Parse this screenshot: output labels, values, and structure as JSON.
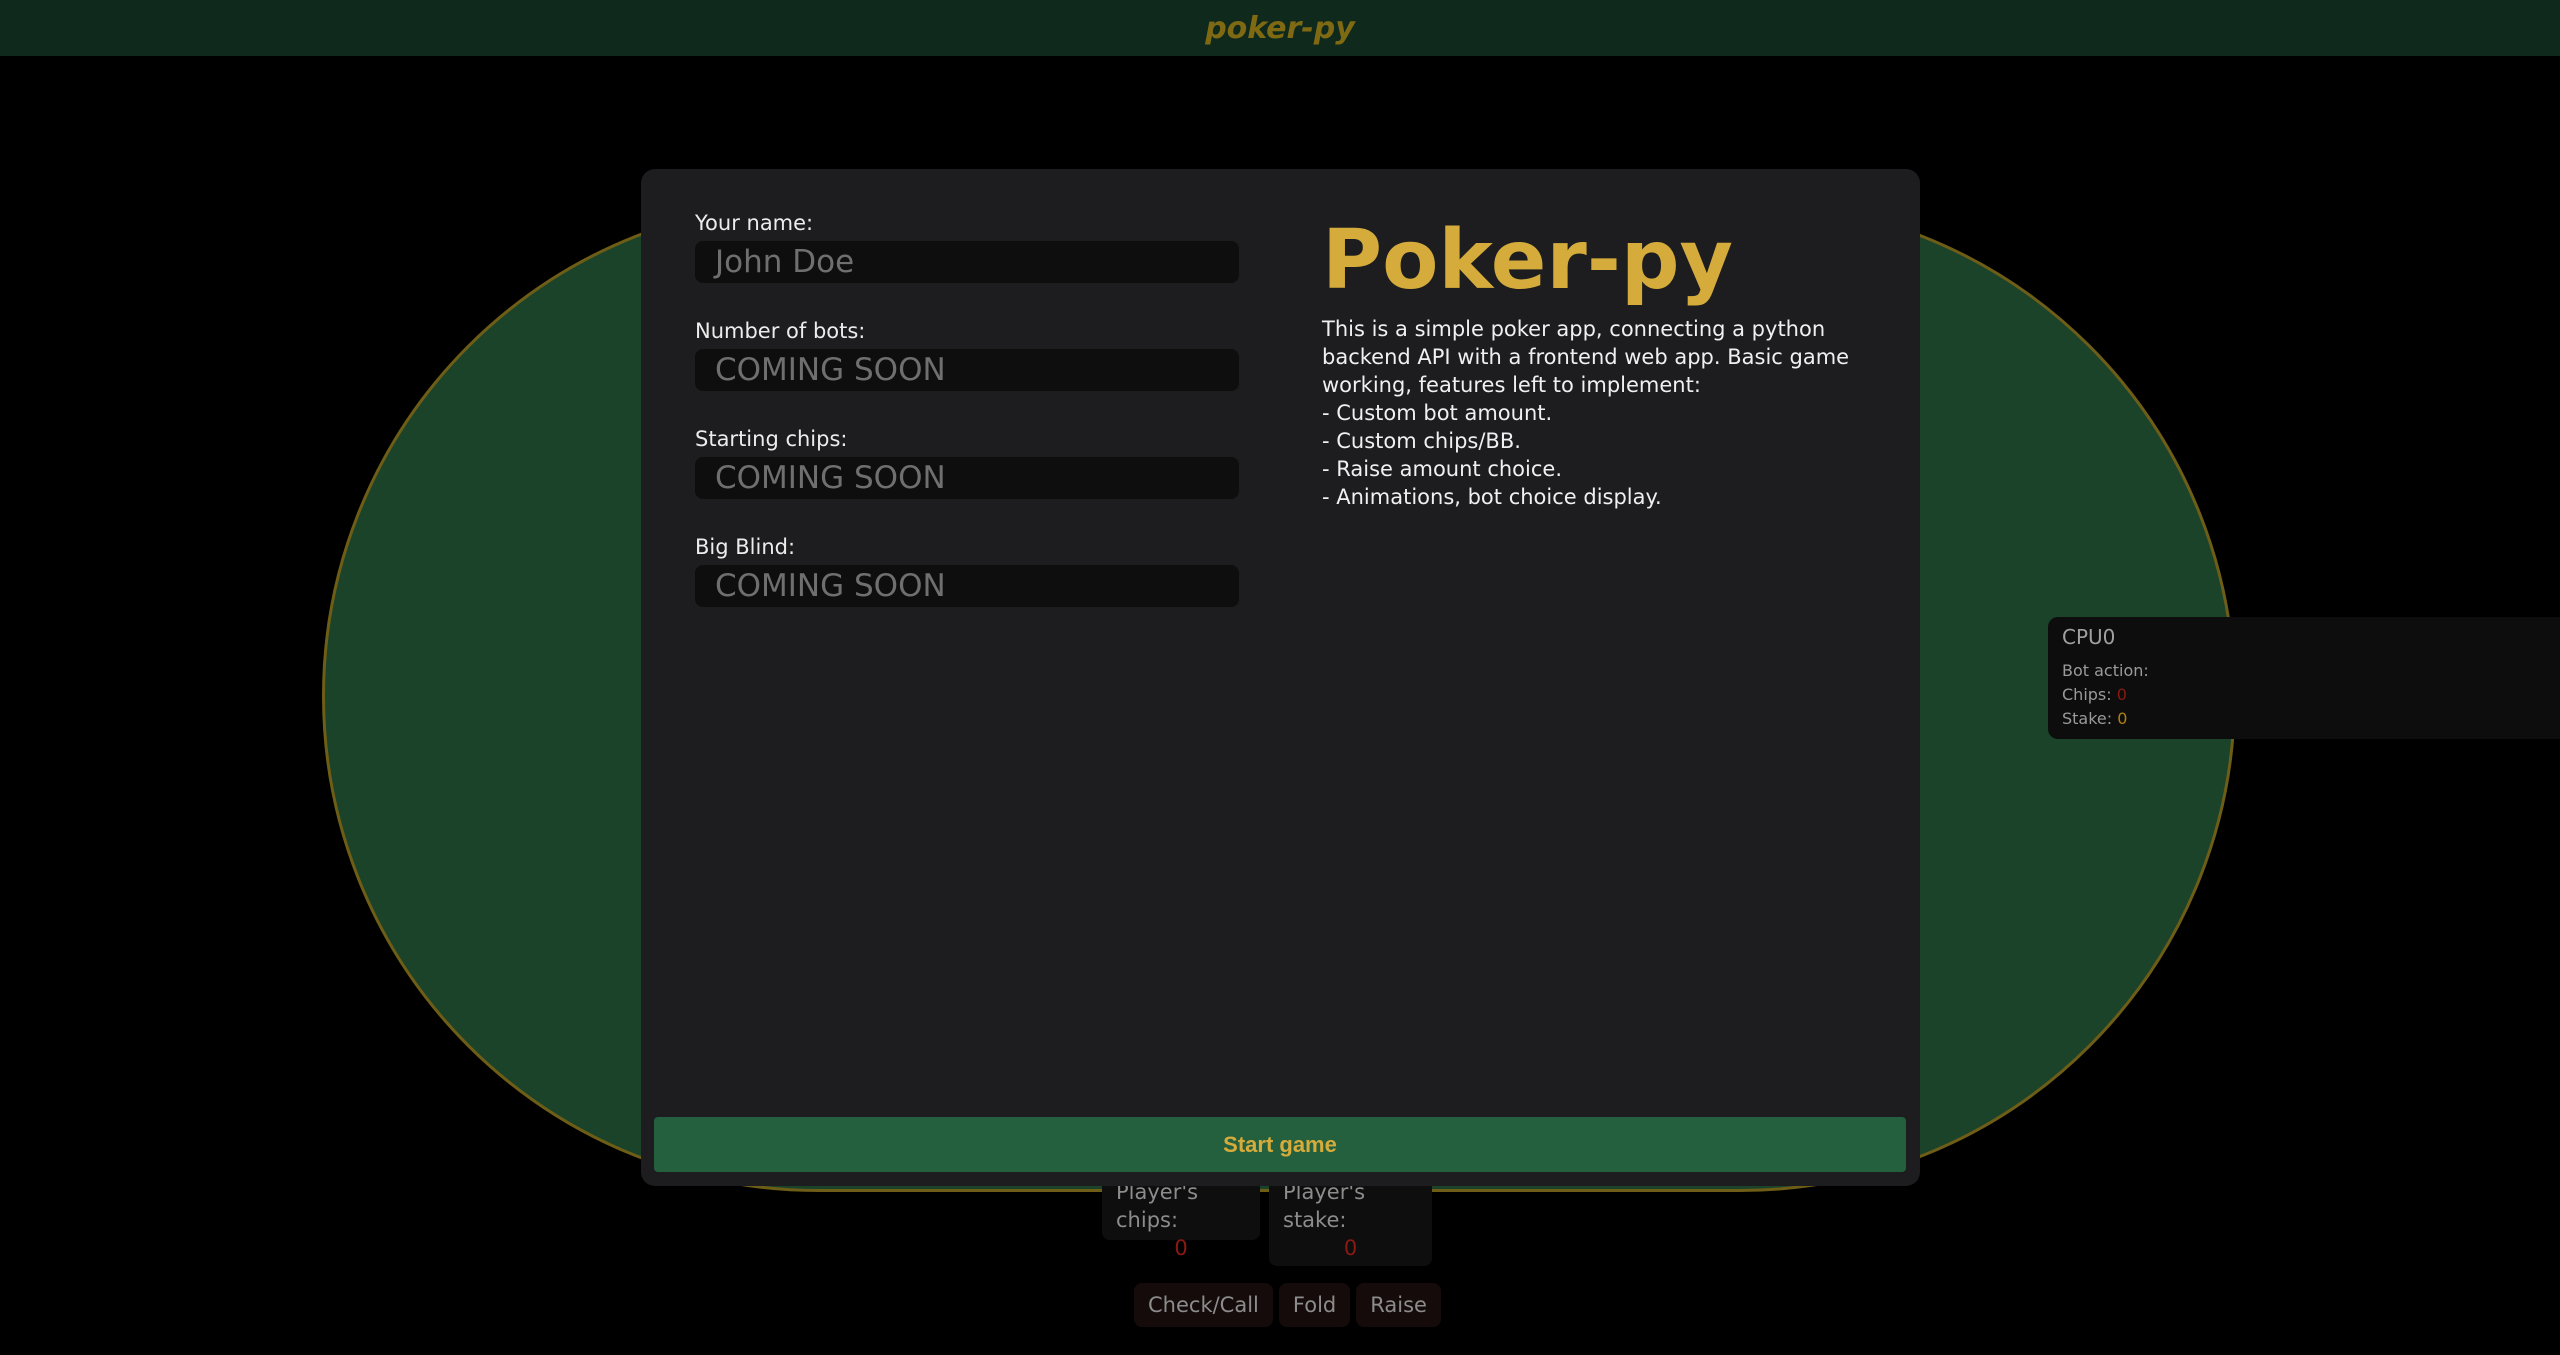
{
  "header": {
    "brand": "poker-py"
  },
  "bot": {
    "name": "CPU0",
    "action_label": "Bot action:",
    "chips_label": "Chips:",
    "chips_value": "0",
    "stake_label": "Stake:",
    "stake_value": "0"
  },
  "player": {
    "chips_label": "Player's chips:",
    "chips_value": "0",
    "stake_label": "Player's stake:",
    "stake_value": "0"
  },
  "actions": {
    "check_call": "Check/Call",
    "fold": "Fold",
    "raise": "Raise"
  },
  "modal": {
    "form": {
      "name_label": "Your name:",
      "name_placeholder": "John Doe",
      "bots_label": "Number of bots:",
      "bots_placeholder": "COMING SOON",
      "chips_label": "Starting chips:",
      "chips_placeholder": "COMING SOON",
      "blind_label": "Big Blind:",
      "blind_placeholder": "COMING SOON"
    },
    "info": {
      "title": "Poker-py",
      "lines": [
        "This is a simple poker app, connecting a python backend API with a frontend web app. Basic game working, features left to implement:",
        "- Custom bot amount.",
        "- Custom chips/BB.",
        "- Raise amount choice.",
        "- Animations, bot choice display."
      ]
    },
    "start_label": "Start game"
  },
  "colors": {
    "accent_gold": "#d5ac3b",
    "table_green": "#1b4329",
    "button_green": "#245f3e",
    "chips_red": "#8a1a12"
  }
}
